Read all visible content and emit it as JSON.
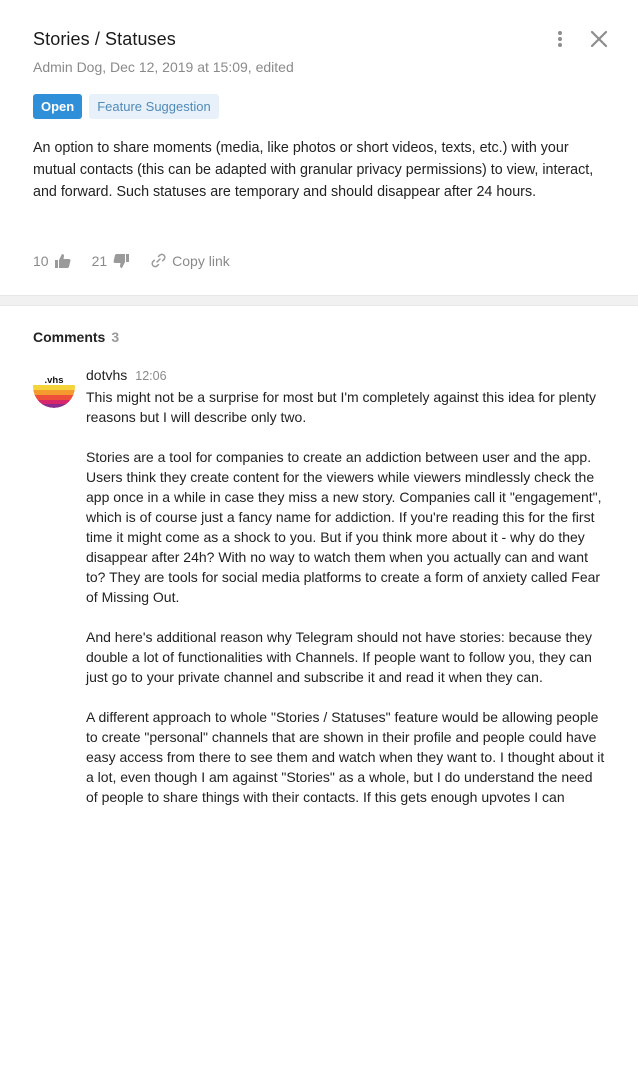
{
  "issue": {
    "title": "Stories / Statuses",
    "meta": "Admin Dog, Dec 12, 2019 at 15:09, edited",
    "status_tag": "Open",
    "type_tag": "Feature Suggestion",
    "description": "An option to share moments (media, like photos or short videos, texts, etc.) with your mutual contacts (this can be adapted with granular privacy permissions) to view, interact, and forward. Such statuses are temporary and should disappear after 24 hours.",
    "upvotes": "10",
    "downvotes": "21",
    "copy_link_label": "Copy link"
  },
  "icons": {
    "menu": "more-vertical-icon",
    "close": "close-icon",
    "upvote": "thumbs-up-icon",
    "downvote": "thumbs-down-icon",
    "link": "link-icon"
  },
  "colors": {
    "open_tag": "#2f8fd8",
    "type_tag_bg": "#e8f1f9",
    "type_tag_text": "#4f8ab8"
  },
  "comments": {
    "heading": "Comments",
    "count": "3",
    "items": [
      {
        "avatar_text": ".vhs",
        "author": "dotvhs",
        "time": "12:06",
        "paragraphs": [
          "This might not be a surprise for most but I'm completely against this idea for plenty reasons but I will describe only two.",
          "Stories are a tool for companies to create an addiction between user and the app. Users think they create content for the viewers while viewers mindlessly check the app once in a while in case they miss a new story. Companies call it \"engagement\", which is of course just a fancy name for addiction. If you're reading this for the first time it might come as a shock to you. But if you think more about it - why do they disappear after 24h? With no way to watch them when you actually can and want to? They are tools for social media platforms to create a form of anxiety called Fear of Missing Out.",
          "And here's additional reason why Telegram should not have stories: because they double a lot of functionalities with Channels. If people want to follow you, they can just go to your private channel and subscribe it and read it when they can.",
          "A different approach to whole \"Stories / Statuses\" feature would be allowing people to create \"personal\" channels that are shown in their profile and people could have easy access from there to see them and watch when they want to. I thought about it a lot, even though I am against \"Stories\" as a whole, but I do understand the need of people to share things with their contacts. If this gets enough upvotes I can"
        ]
      }
    ]
  }
}
